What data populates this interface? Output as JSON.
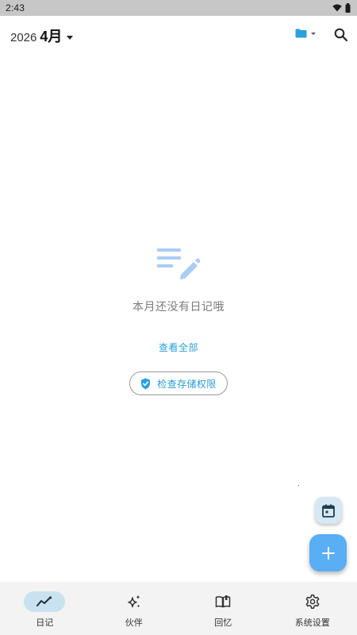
{
  "status_bar": {
    "time": "2:43",
    "icons": [
      "wifi-icon",
      "battery-icon"
    ]
  },
  "header": {
    "year": "2026",
    "month": "4月",
    "folder_icon": "folder-icon",
    "search_icon": "search-icon"
  },
  "empty_state": {
    "icon": "edit-list-icon",
    "message": "本月还没有日记哦",
    "view_all_label": "查看全部",
    "check_storage_label": "检查存储权限",
    "check_storage_icon": "shield-check-icon"
  },
  "fabs": {
    "calendar_icon": "calendar-icon",
    "add_icon": "plus-icon"
  },
  "bottom_nav": {
    "items": [
      {
        "label": "日记",
        "icon": "trend-line-icon",
        "active": true
      },
      {
        "label": "伙伴",
        "icon": "sparkles-icon",
        "active": false
      },
      {
        "label": "回忆",
        "icon": "book-icon",
        "active": false
      },
      {
        "label": "系统设置",
        "icon": "gear-icon",
        "active": false
      }
    ]
  },
  "colors": {
    "accent": "#2aa0d8",
    "fab": "#5aaef3",
    "fab_secondary": "#d5e8f3",
    "nav_active_pill": "#c9e2f0",
    "status_bar": "#c7c7c7",
    "empty_icon": "#a9cdf5"
  }
}
